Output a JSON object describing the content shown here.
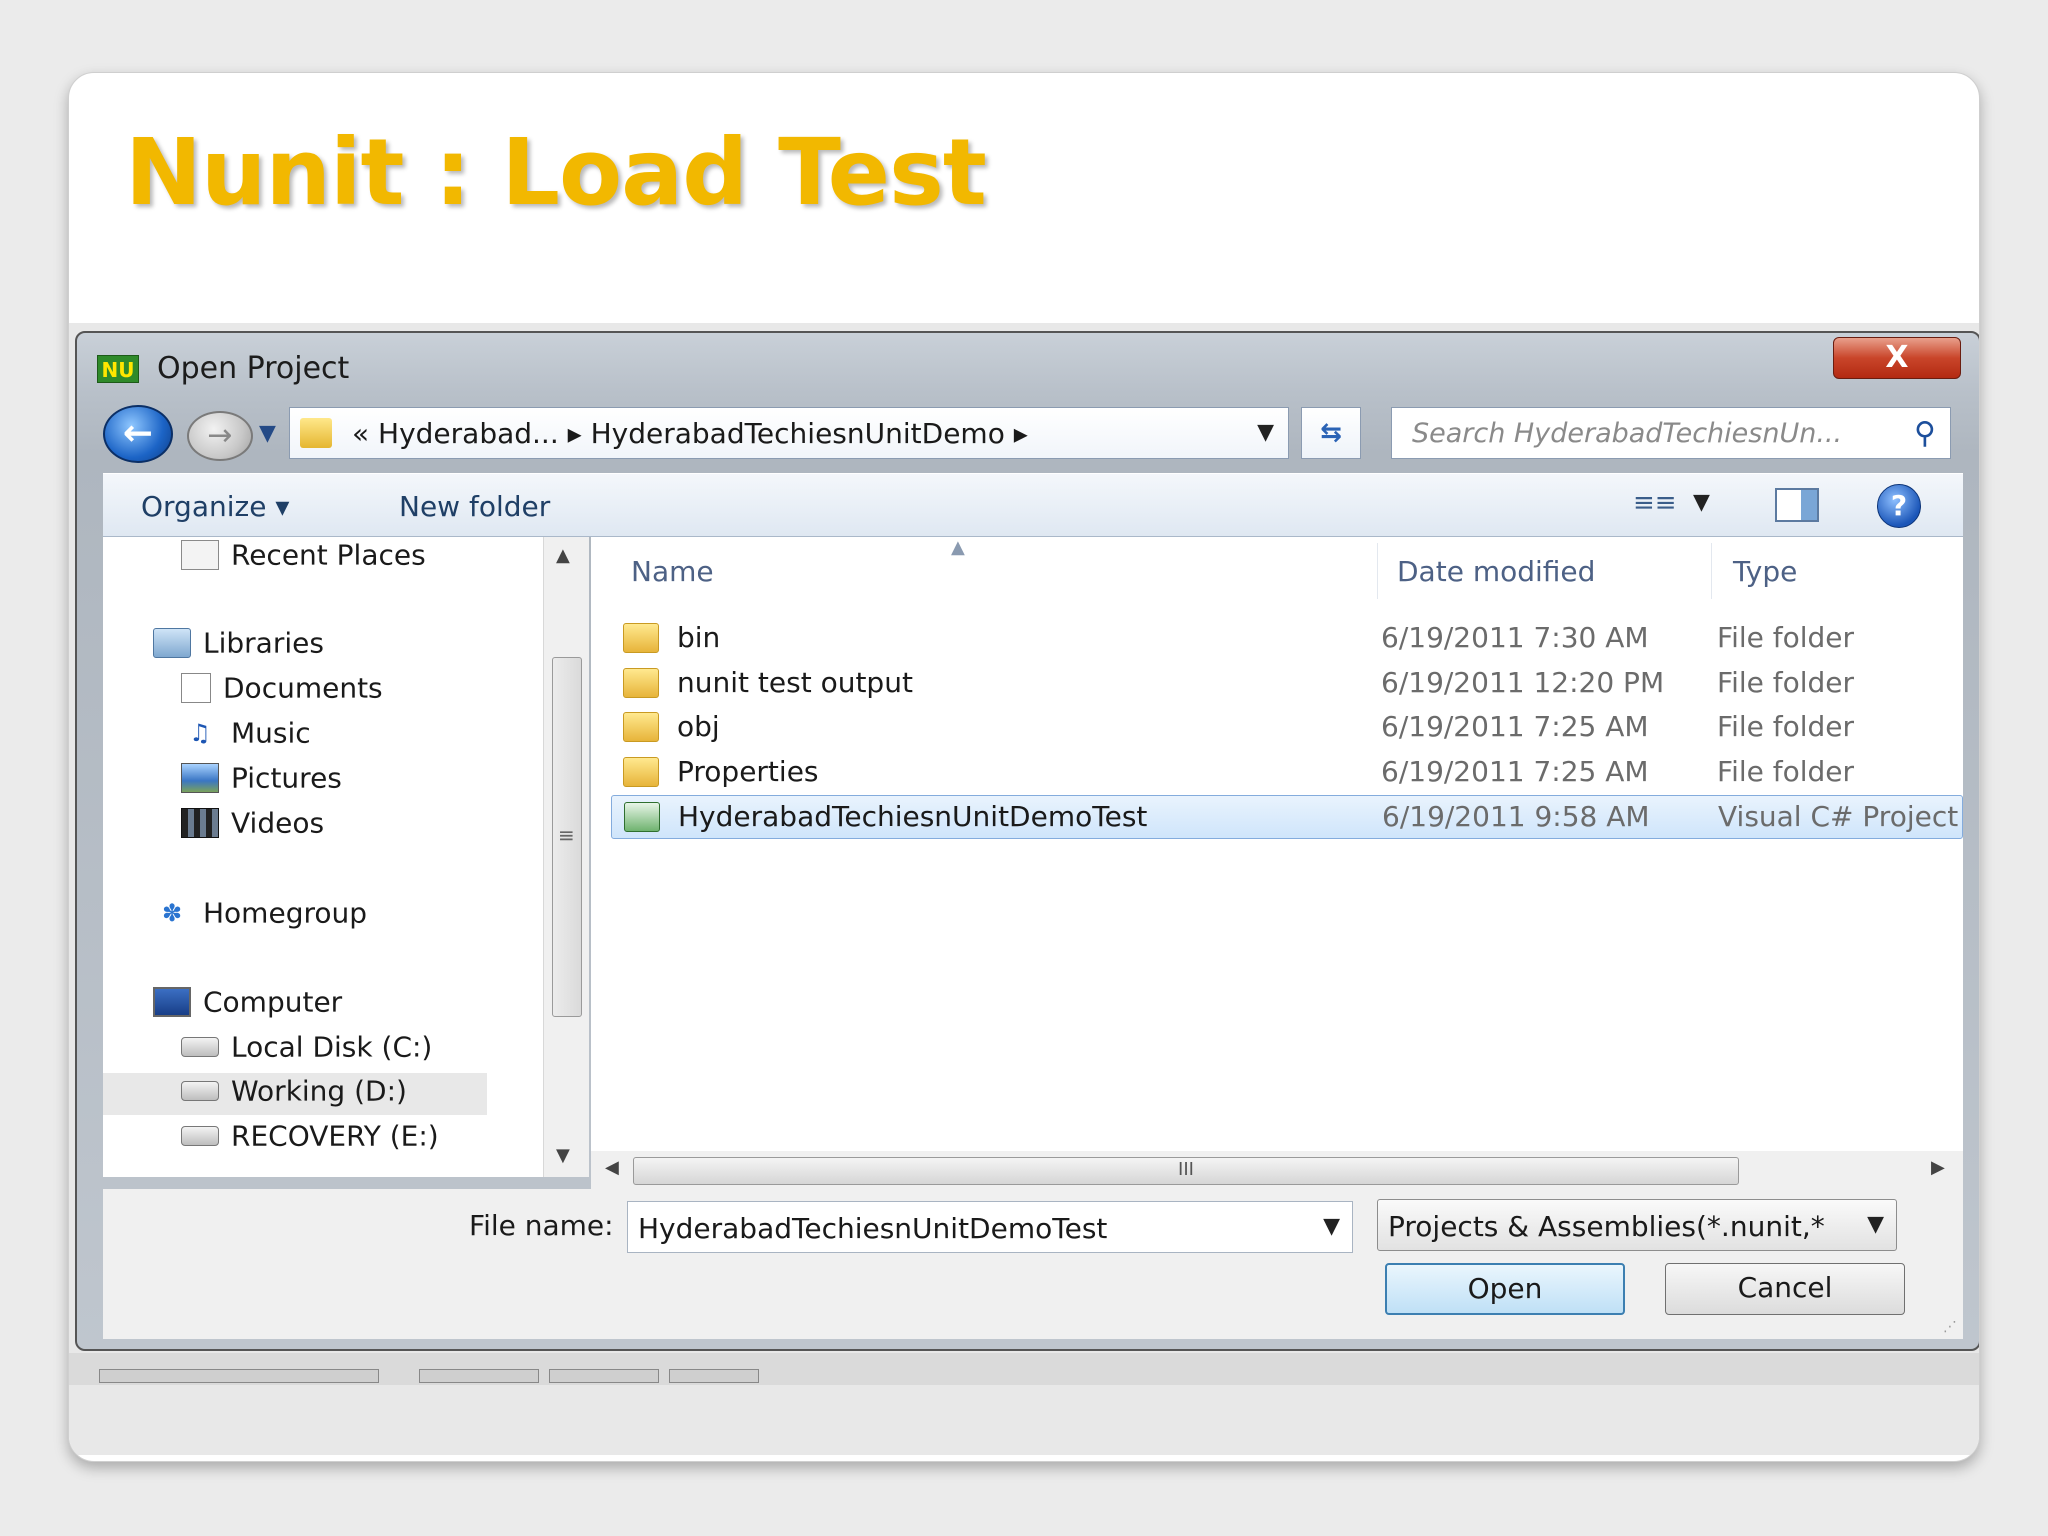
{
  "slide": {
    "title": "Nunit : Load Test"
  },
  "dialog": {
    "title": "Open Project",
    "app_icon": "NU",
    "close_label": "X",
    "address_path": "« Hyderabad... ▸ HyderabadTechiesnUnitDemo ▸",
    "search_placeholder": "Search HyderabadTechiesnUn...",
    "toolbar": {
      "organize": "Organize ▾",
      "new_folder": "New folder",
      "help": "?"
    },
    "nav": {
      "items": [
        {
          "label": "Recent Places",
          "icon": "recent-places-icon"
        },
        {
          "label": "Libraries",
          "icon": "libraries-icon"
        },
        {
          "label": "Documents",
          "icon": "documents-icon"
        },
        {
          "label": "Music",
          "icon": "music-icon"
        },
        {
          "label": "Pictures",
          "icon": "pictures-icon"
        },
        {
          "label": "Videos",
          "icon": "videos-icon"
        },
        {
          "label": "Homegroup",
          "icon": "homegroup-icon"
        },
        {
          "label": "Computer",
          "icon": "computer-icon"
        },
        {
          "label": "Local Disk (C:)",
          "icon": "local-disk-icon"
        },
        {
          "label": "Working (D:)",
          "icon": "drive-icon"
        },
        {
          "label": "RECOVERY (E:)",
          "icon": "drive-icon"
        }
      ],
      "selected": "Working (D:)"
    },
    "columns": {
      "name": "Name",
      "date": "Date modified",
      "type": "Type"
    },
    "files": [
      {
        "name": "bin",
        "date": "6/19/2011 7:30 AM",
        "type": "File folder",
        "icon": "folder-icon"
      },
      {
        "name": "nunit test output",
        "date": "6/19/2011 12:20 PM",
        "type": "File folder",
        "icon": "folder-icon"
      },
      {
        "name": "obj",
        "date": "6/19/2011 7:25 AM",
        "type": "File folder",
        "icon": "folder-icon"
      },
      {
        "name": "Properties",
        "date": "6/19/2011 7:25 AM",
        "type": "File folder",
        "icon": "folder-icon"
      },
      {
        "name": "HyderabadTechiesnUnitDemoTest",
        "date": "6/19/2011 9:58 AM",
        "type": "Visual C# Project f...",
        "icon": "csharp-project-icon"
      }
    ],
    "selected_file": "HyderabadTechiesnUnitDemoTest",
    "hscroll_grip": "III",
    "file_name_label": "File name:",
    "file_name_value": "HyderabadTechiesnUnitDemoTest",
    "filter_value": "Projects & Assemblies(*.nunit,*",
    "open_label": "Open",
    "cancel_label": "Cancel"
  },
  "colors": {
    "title_accent": "#f2b800",
    "selection": "#cfe5fb",
    "close_button": "#c9452a"
  }
}
